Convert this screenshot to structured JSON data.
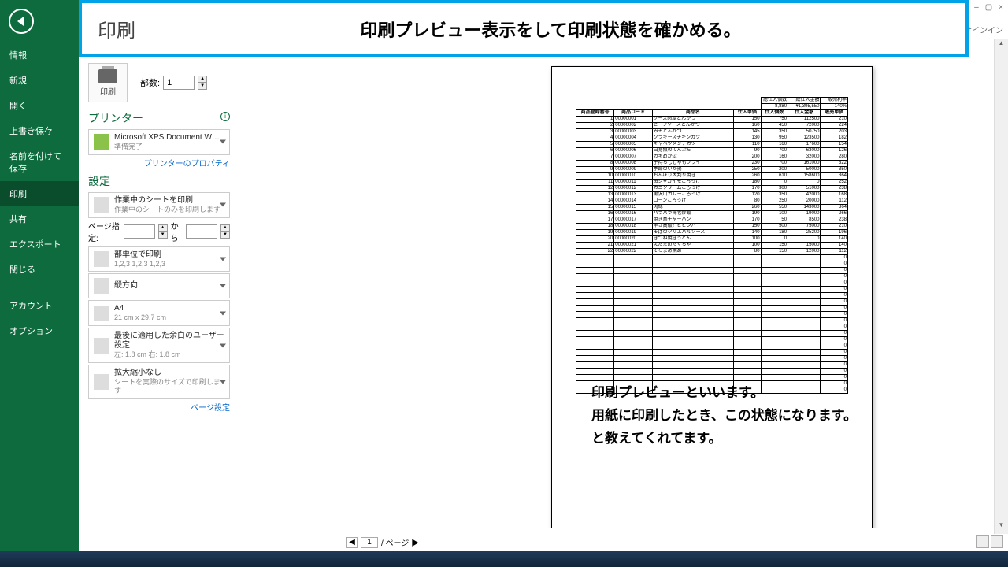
{
  "window": {
    "min": "–",
    "max": "▢",
    "close": "×",
    "help": "?",
    "signin": "サインイン"
  },
  "sidebar": {
    "items": [
      {
        "label": "情報"
      },
      {
        "label": "新規"
      },
      {
        "label": "開く"
      },
      {
        "label": "上書き保存"
      },
      {
        "label": "名前を付けて保存"
      },
      {
        "label": "印刷",
        "sel": true
      },
      {
        "label": "共有"
      },
      {
        "label": "エクスポート"
      },
      {
        "label": "閉じる"
      }
    ],
    "lower": [
      {
        "label": "アカウント"
      },
      {
        "label": "オプション"
      }
    ]
  },
  "banner": {
    "title": "印刷",
    "msg": "印刷プレビュー表示をして印刷状態を確かめる。"
  },
  "print_button": "印刷",
  "copies": {
    "label": "部数:",
    "value": "1"
  },
  "printer": {
    "label": "プリンター",
    "name": "Microsoft XPS Document W…",
    "status": "準備完了",
    "props": "プリンターのプロパティ"
  },
  "settings": {
    "label": "設定",
    "active_sheets": {
      "t1": "作業中のシートを印刷",
      "t2": "作業中のシートのみを印刷します"
    },
    "pages": {
      "label": "ページ指定:",
      "to": "から"
    },
    "collate": {
      "t1": "部単位で印刷",
      "t2": "1,2,3   1,2,3   1,2,3"
    },
    "orient": {
      "t1": "縦方向"
    },
    "paper": {
      "t1": "A4",
      "t2": "21 cm x 29.7 cm"
    },
    "margins": {
      "t1": "最後に適用した余白のユーザー設定",
      "t2": "左: 1.8 cm   右: 1.8 cm"
    },
    "scaling": {
      "t1": "拡大縮小なし",
      "t2": "シートを実際のサイズで印刷します"
    },
    "pagesetup": "ページ設定"
  },
  "nav": {
    "cur": "1",
    "total": "/ ページ ▶"
  },
  "annot": {
    "l1": "印刷プレビューといいます。",
    "l2": "用紙に印刷したとき、この状態になります。",
    "l3": "と教えてくれてます。"
  },
  "chart_data": {
    "type": "table",
    "summary": {
      "a": "総仕入個数",
      "b": "総仕入金額",
      "c": "販売利率",
      "va": "8,880",
      "vb": "¥1,395,550",
      "vc": "140%"
    },
    "headers": [
      "商品登録番号",
      "商品コード",
      "商品名",
      "仕入単価",
      "仕入個数",
      "仕入金額",
      "販売単価"
    ],
    "rows": [
      [
        "1",
        "00000001",
        "ソース肉厚とんかつ",
        "150",
        "750",
        "112500",
        "210"
      ],
      [
        "2",
        "00000002",
        "ビーフソースとんかつ",
        "160",
        "450",
        "72000",
        "224"
      ],
      [
        "3",
        "00000003",
        "みそとんかつ",
        "145",
        "350",
        "50750",
        "203"
      ],
      [
        "4",
        "00000004",
        "クラキーズチキンカツ",
        "130",
        "950",
        "123500",
        "182"
      ],
      [
        "5",
        "00000005",
        "キャベツメンチカツ",
        "110",
        "160",
        "17600",
        "154"
      ],
      [
        "6",
        "00000006",
        "白身魚のてんぷら",
        "90",
        "700",
        "63000",
        "126"
      ],
      [
        "7",
        "00000007",
        "カキめかぶ",
        "200",
        "160",
        "32000",
        "280"
      ],
      [
        "8",
        "00000008",
        "子持ちししゃもフライ",
        "230",
        "700",
        "161000",
        "322"
      ],
      [
        "9",
        "00000009",
        "季節のいか揚",
        "250",
        "200",
        "50000",
        "350"
      ],
      [
        "10",
        "00000010",
        "おんぼり大判り焼き",
        "260",
        "610",
        "158600",
        "364"
      ],
      [
        "11",
        "00000011",
        "苺ジャガイモころっけ",
        "180",
        "0",
        "0",
        "252"
      ],
      [
        "12",
        "00000012",
        "カニクリームころっけ",
        "170",
        "300",
        "51000",
        "238"
      ],
      [
        "13",
        "00000013",
        "黒沢山カレーころっけ",
        "120",
        "350",
        "42000",
        "168"
      ],
      [
        "14",
        "00000014",
        "コーンころっけ",
        "80",
        "250",
        "20000",
        "112"
      ],
      [
        "15",
        "00000015",
        "肉絲",
        "260",
        "550",
        "143000",
        "364"
      ],
      [
        "16",
        "00000016",
        "パラパラ海老炒飯",
        "190",
        "100",
        "19000",
        "266"
      ],
      [
        "17",
        "00000017",
        "焼き鳥チャーハン",
        "170",
        "50",
        "8500",
        "238"
      ],
      [
        "18",
        "00000018",
        "辛さ高級！ビビンバ",
        "150",
        "500",
        "75000",
        "210"
      ],
      [
        "19",
        "00000019",
        "そばのクリエバルソース",
        "140",
        "180",
        "25200",
        "196"
      ],
      [
        "20",
        "00000020",
        "きつね焼きうどん",
        "100",
        "0",
        "0",
        "140"
      ],
      [
        "21",
        "00000021",
        "えだまめたくちゃ",
        "100",
        "150",
        "15000",
        "140"
      ],
      [
        "22",
        "00000022",
        "そらまめ焼め",
        "80",
        "150",
        "12000",
        "112"
      ]
    ],
    "empty_rows": 22
  }
}
